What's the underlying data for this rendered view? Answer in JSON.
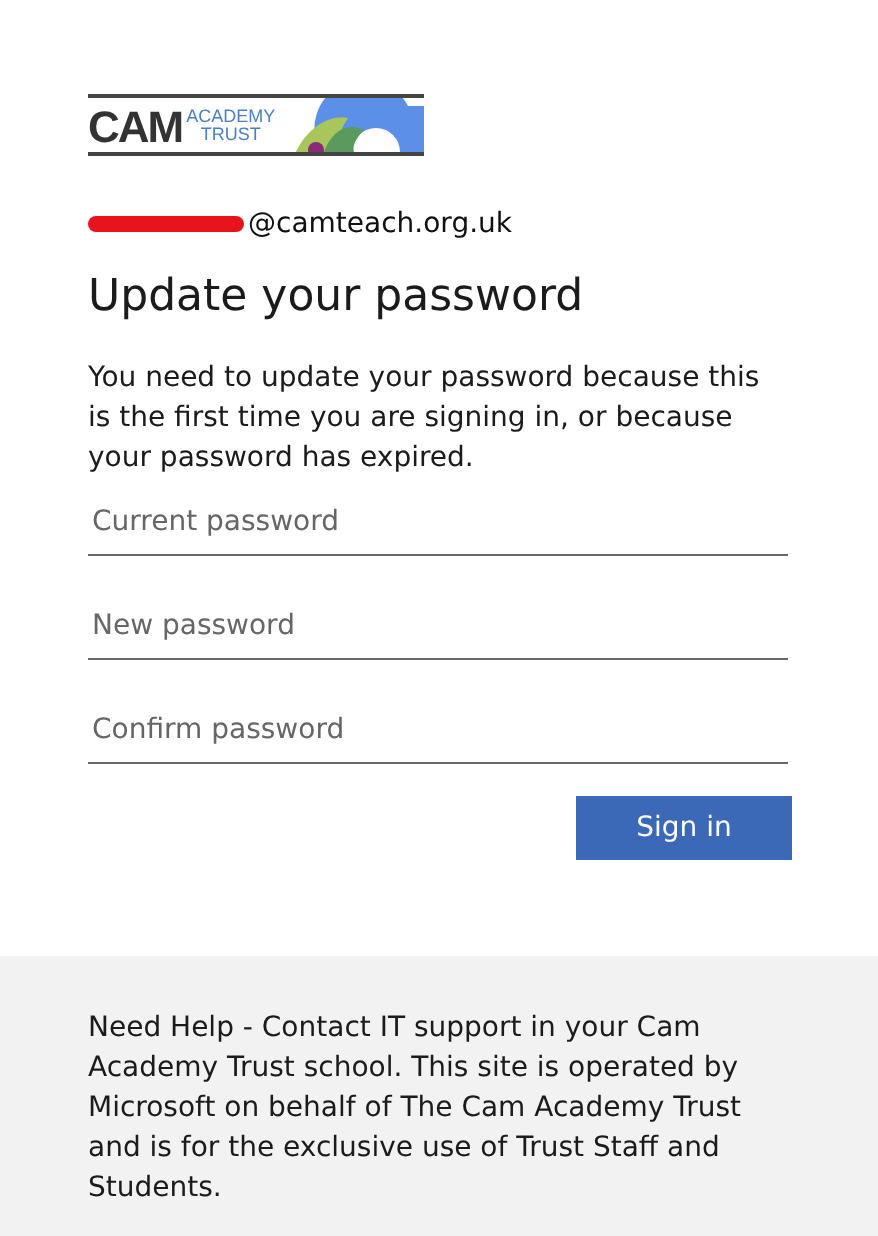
{
  "logo": {
    "name": "CAM",
    "line_1": "ACADEMY",
    "line_2": "TRUST"
  },
  "account": {
    "email_visible": "@camteach.org.uk",
    "redacted": true
  },
  "title": "Update your password",
  "message": "You need to update your password because this is the first time you are signing in, or because your password has expired.",
  "fields": [
    {
      "placeholder": "Current password"
    },
    {
      "placeholder": "New password"
    },
    {
      "placeholder": "Confirm password"
    }
  ],
  "button": "Sign in",
  "footer": "Need Help - Contact IT support in your Cam Academy Trust school. This site is operated by Microsoft on behalf of The Cam Academy Trust and is for the exclusive use of Trust Staff and Students."
}
